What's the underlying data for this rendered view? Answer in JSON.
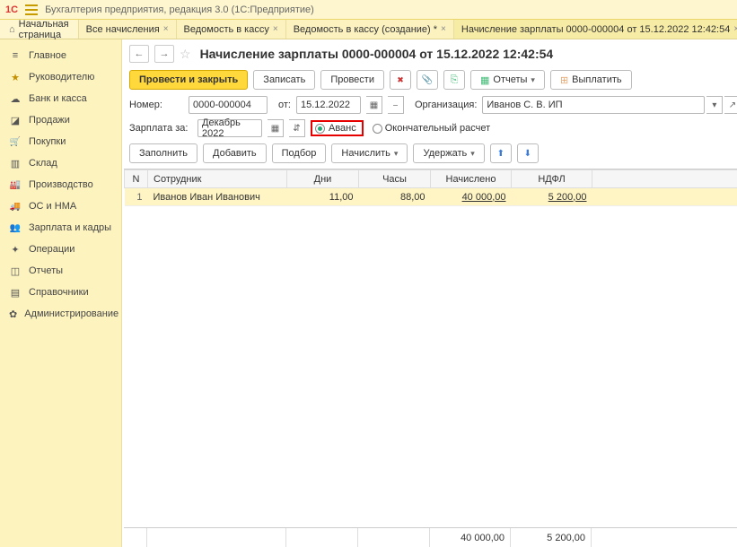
{
  "titlebar": {
    "logo": "1C",
    "text": "Бухгалтерия предприятия, редакция 3.0  (1С:Предприятие)"
  },
  "tabs": {
    "home": "Начальная страница",
    "items": [
      {
        "label": "Все начисления"
      },
      {
        "label": "Ведомость в кассу"
      },
      {
        "label": "Ведомость в кассу (создание) *"
      },
      {
        "label": "Начисление зарплаты 0000-000004 от 15.12.2022 12:42:54",
        "active": true
      }
    ]
  },
  "sidebar": [
    {
      "icon": "si-lines",
      "label": "Главное"
    },
    {
      "icon": "si-star",
      "label": "Руководителю"
    },
    {
      "icon": "si-cloud",
      "label": "Банк и касса"
    },
    {
      "icon": "si-tag",
      "label": "Продажи"
    },
    {
      "icon": "si-cart",
      "label": "Покупки"
    },
    {
      "icon": "si-box",
      "label": "Склад"
    },
    {
      "icon": "si-fact",
      "label": "Производство"
    },
    {
      "icon": "si-truck",
      "label": "ОС и НМА"
    },
    {
      "icon": "si-people",
      "label": "Зарплата и кадры"
    },
    {
      "icon": "si-gear",
      "label": "Операции"
    },
    {
      "icon": "si-chart",
      "label": "Отчеты"
    },
    {
      "icon": "si-book",
      "label": "Справочники"
    },
    {
      "icon": "si-wrench",
      "label": "Администрирование"
    }
  ],
  "page": {
    "title": "Начисление зарплаты 0000-000004 от 15.12.2022 12:42:54"
  },
  "toolbar1": {
    "post_close": "Провести и закрыть",
    "save": "Записать",
    "post": "Провести",
    "reports": "Отчеты",
    "pay": "Выплатить"
  },
  "form": {
    "number_label": "Номер:",
    "number_value": "0000-000004",
    "date_label": "от:",
    "date_value": "15.12.2022",
    "org_label": "Организация:",
    "org_value": "Иванов С. В. ИП",
    "period_label": "Зарплата за:",
    "period_value": "Декабрь 2022",
    "radio_advance": "Аванс",
    "radio_final": "Окончательный расчет"
  },
  "toolbar2": {
    "fill": "Заполнить",
    "add": "Добавить",
    "select": "Подбор",
    "accrue": "Начислить",
    "withhold": "Удержать"
  },
  "table": {
    "headers": {
      "n": "N",
      "employee": "Сотрудник",
      "days": "Дни",
      "hours": "Часы",
      "accrued": "Начислено",
      "ndfl": "НДФЛ"
    },
    "rows": [
      {
        "n": "1",
        "employee": "Иванов Иван Иванович",
        "days": "11,00",
        "hours": "88,00",
        "accrued": "40 000,00",
        "ndfl": "5 200,00"
      }
    ],
    "footer": {
      "accrued": "40 000,00",
      "ndfl": "5 200,00"
    }
  }
}
